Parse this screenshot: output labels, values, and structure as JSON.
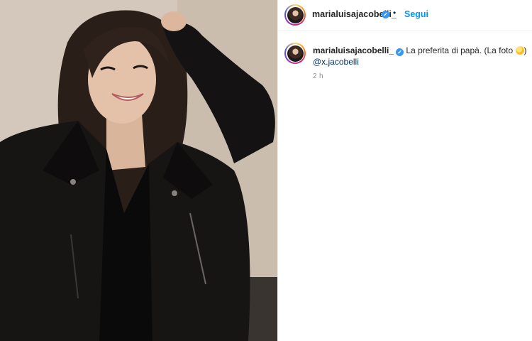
{
  "post": {
    "username": "marialuisajacobelli_",
    "verified_icon": "verified-badge-icon",
    "separator": "•",
    "follow_label": "Segui",
    "caption": {
      "username": "marialuisajacobelli_",
      "text": "La preferita di papà. (La foto",
      "emoji": "grinning-face-emoji",
      "text_end": ")",
      "mention": "@x.jacobelli"
    },
    "time": "2 h"
  },
  "colors": {
    "accent": "#0095f6",
    "verified": "#3897f0",
    "mention": "#00376b",
    "muted": "#8e8e8e"
  }
}
